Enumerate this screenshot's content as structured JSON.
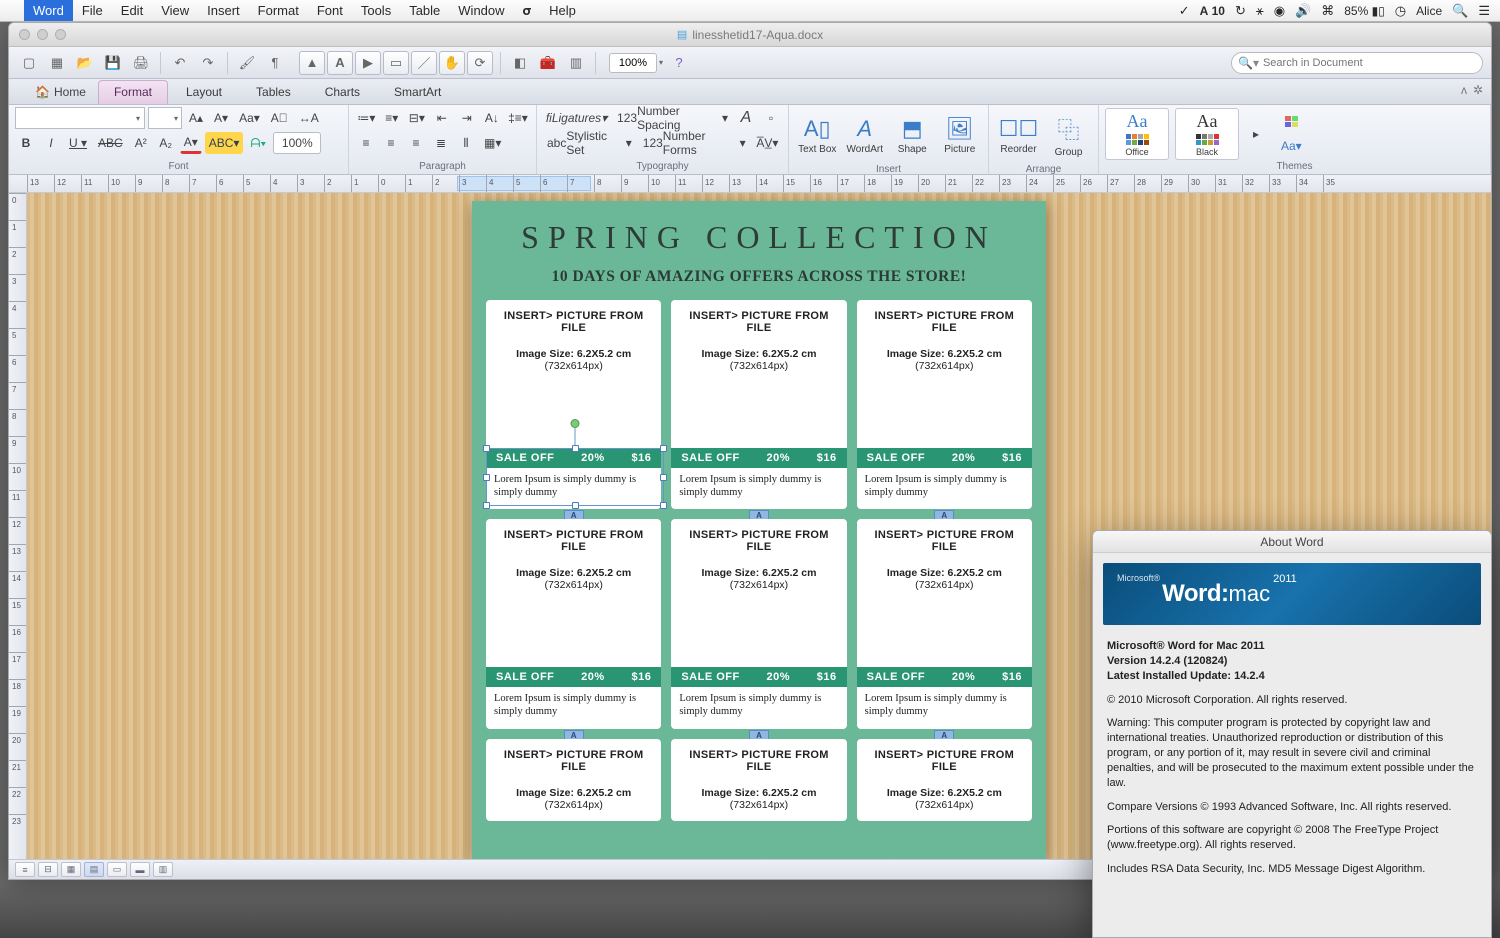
{
  "menubar": {
    "app": "Word",
    "items": [
      "File",
      "Edit",
      "View",
      "Insert",
      "Format",
      "Font",
      "Tools",
      "Table",
      "Window",
      "Help"
    ],
    "right": {
      "ai": "10",
      "battery": "85%",
      "user": "Alice"
    }
  },
  "window": {
    "title": "linesshetid17-Aqua.docx"
  },
  "qat": {
    "zoom": "100%",
    "search_ph": "Search in Document"
  },
  "ribbon_tabs": [
    "Home",
    "Format",
    "Layout",
    "Tables",
    "Charts",
    "SmartArt"
  ],
  "ribbon": {
    "groups": {
      "font": "Font",
      "paragraph": "Paragraph",
      "typography": "Typography",
      "insert": "Insert",
      "arrange": "Arrange",
      "themes": "Themes"
    },
    "zoom": "100%",
    "ligatures": "Ligatures",
    "numspacing": "Number Spacing",
    "stylset": "Stylistic Set",
    "numforms": "Number Forms",
    "insert_btns": {
      "textbox": "Text Box",
      "wordart": "WordArt",
      "shape": "Shape",
      "picture": "Picture"
    },
    "arrange_btns": {
      "reorder": "Reorder",
      "group": "Group"
    },
    "theme_cards": [
      "Office",
      "Black"
    ]
  },
  "doc": {
    "title": "SPRING COLLECTION",
    "subtitle": "10 DAYS OF AMAZING OFFERS ACROSS THE STORE!",
    "card": {
      "ph1": "INSERT> PICTURE FROM FILE",
      "ph2": "Image Size: 6.2X5.2 cm",
      "ph3": "(732x614px)",
      "bar_sale": "SALE OFF",
      "bar_pct": "20%",
      "bar_price": "$16",
      "desc": "Lorem Ipsum is simply dummy is simply dummy",
      "atab": "A"
    }
  },
  "about": {
    "title": "About Word",
    "banner_ms": "Microsoft®",
    "banner_word": "Word:",
    "banner_mac": "mac",
    "banner_yr": "2011",
    "p1a": "Microsoft® Word for Mac 2011",
    "p1b": "Version 14.2.4 (120824)",
    "p1c": "Latest Installed Update: 14.2.4",
    "p2": "© 2010 Microsoft Corporation. All rights reserved.",
    "p3": "Warning: This computer program is protected by copyright law and international treaties.  Unauthorized reproduction or distribution of this program, or any portion of it, may result in severe civil and criminal penalties, and will be prosecuted to the maximum extent possible under the law.",
    "p4": "Compare Versions © 1993 Advanced Software, Inc.  All rights reserved.",
    "p5": "Portions of this software are copyright © 2008 The FreeType Project (www.freetype.org).  All rights reserved.",
    "p6": "Includes RSA Data Security, Inc. MD5 Message Digest Algorithm."
  }
}
